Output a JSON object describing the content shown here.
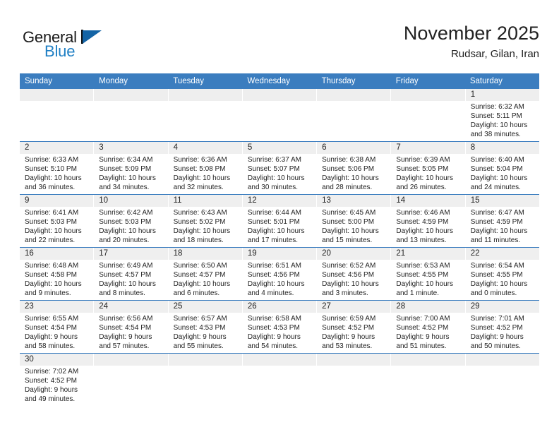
{
  "logo": {
    "word_one": "General",
    "word_two": "Blue",
    "mark": "triangle-flag-icon",
    "blue": "#1f7fc4",
    "dark_blue": "#1464a5"
  },
  "header": {
    "month_title": "November 2025",
    "location": "Rudsar, Gilan, Iran"
  },
  "theme": {
    "header_blue": "#3b7dbf",
    "daynum_band": "#efefef",
    "text": "#222222"
  },
  "weekdays": [
    "Sunday",
    "Monday",
    "Tuesday",
    "Wednesday",
    "Thursday",
    "Friday",
    "Saturday"
  ],
  "weeks": [
    [
      {
        "day": "",
        "sunrise": "",
        "sunset": "",
        "daylight_line1": "",
        "daylight_line2": "",
        "empty": true
      },
      {
        "day": "",
        "sunrise": "",
        "sunset": "",
        "daylight_line1": "",
        "daylight_line2": "",
        "empty": true
      },
      {
        "day": "",
        "sunrise": "",
        "sunset": "",
        "daylight_line1": "",
        "daylight_line2": "",
        "empty": true
      },
      {
        "day": "",
        "sunrise": "",
        "sunset": "",
        "daylight_line1": "",
        "daylight_line2": "",
        "empty": true
      },
      {
        "day": "",
        "sunrise": "",
        "sunset": "",
        "daylight_line1": "",
        "daylight_line2": "",
        "empty": true
      },
      {
        "day": "",
        "sunrise": "",
        "sunset": "",
        "daylight_line1": "",
        "daylight_line2": "",
        "empty": true
      },
      {
        "day": "1",
        "sunrise": "Sunrise: 6:32 AM",
        "sunset": "Sunset: 5:11 PM",
        "daylight_line1": "Daylight: 10 hours",
        "daylight_line2": "and 38 minutes.",
        "empty": false
      }
    ],
    [
      {
        "day": "2",
        "sunrise": "Sunrise: 6:33 AM",
        "sunset": "Sunset: 5:10 PM",
        "daylight_line1": "Daylight: 10 hours",
        "daylight_line2": "and 36 minutes.",
        "empty": false
      },
      {
        "day": "3",
        "sunrise": "Sunrise: 6:34 AM",
        "sunset": "Sunset: 5:09 PM",
        "daylight_line1": "Daylight: 10 hours",
        "daylight_line2": "and 34 minutes.",
        "empty": false
      },
      {
        "day": "4",
        "sunrise": "Sunrise: 6:36 AM",
        "sunset": "Sunset: 5:08 PM",
        "daylight_line1": "Daylight: 10 hours",
        "daylight_line2": "and 32 minutes.",
        "empty": false
      },
      {
        "day": "5",
        "sunrise": "Sunrise: 6:37 AM",
        "sunset": "Sunset: 5:07 PM",
        "daylight_line1": "Daylight: 10 hours",
        "daylight_line2": "and 30 minutes.",
        "empty": false
      },
      {
        "day": "6",
        "sunrise": "Sunrise: 6:38 AM",
        "sunset": "Sunset: 5:06 PM",
        "daylight_line1": "Daylight: 10 hours",
        "daylight_line2": "and 28 minutes.",
        "empty": false
      },
      {
        "day": "7",
        "sunrise": "Sunrise: 6:39 AM",
        "sunset": "Sunset: 5:05 PM",
        "daylight_line1": "Daylight: 10 hours",
        "daylight_line2": "and 26 minutes.",
        "empty": false
      },
      {
        "day": "8",
        "sunrise": "Sunrise: 6:40 AM",
        "sunset": "Sunset: 5:04 PM",
        "daylight_line1": "Daylight: 10 hours",
        "daylight_line2": "and 24 minutes.",
        "empty": false
      }
    ],
    [
      {
        "day": "9",
        "sunrise": "Sunrise: 6:41 AM",
        "sunset": "Sunset: 5:03 PM",
        "daylight_line1": "Daylight: 10 hours",
        "daylight_line2": "and 22 minutes.",
        "empty": false
      },
      {
        "day": "10",
        "sunrise": "Sunrise: 6:42 AM",
        "sunset": "Sunset: 5:03 PM",
        "daylight_line1": "Daylight: 10 hours",
        "daylight_line2": "and 20 minutes.",
        "empty": false
      },
      {
        "day": "11",
        "sunrise": "Sunrise: 6:43 AM",
        "sunset": "Sunset: 5:02 PM",
        "daylight_line1": "Daylight: 10 hours",
        "daylight_line2": "and 18 minutes.",
        "empty": false
      },
      {
        "day": "12",
        "sunrise": "Sunrise: 6:44 AM",
        "sunset": "Sunset: 5:01 PM",
        "daylight_line1": "Daylight: 10 hours",
        "daylight_line2": "and 17 minutes.",
        "empty": false
      },
      {
        "day": "13",
        "sunrise": "Sunrise: 6:45 AM",
        "sunset": "Sunset: 5:00 PM",
        "daylight_line1": "Daylight: 10 hours",
        "daylight_line2": "and 15 minutes.",
        "empty": false
      },
      {
        "day": "14",
        "sunrise": "Sunrise: 6:46 AM",
        "sunset": "Sunset: 4:59 PM",
        "daylight_line1": "Daylight: 10 hours",
        "daylight_line2": "and 13 minutes.",
        "empty": false
      },
      {
        "day": "15",
        "sunrise": "Sunrise: 6:47 AM",
        "sunset": "Sunset: 4:59 PM",
        "daylight_line1": "Daylight: 10 hours",
        "daylight_line2": "and 11 minutes.",
        "empty": false
      }
    ],
    [
      {
        "day": "16",
        "sunrise": "Sunrise: 6:48 AM",
        "sunset": "Sunset: 4:58 PM",
        "daylight_line1": "Daylight: 10 hours",
        "daylight_line2": "and 9 minutes.",
        "empty": false
      },
      {
        "day": "17",
        "sunrise": "Sunrise: 6:49 AM",
        "sunset": "Sunset: 4:57 PM",
        "daylight_line1": "Daylight: 10 hours",
        "daylight_line2": "and 8 minutes.",
        "empty": false
      },
      {
        "day": "18",
        "sunrise": "Sunrise: 6:50 AM",
        "sunset": "Sunset: 4:57 PM",
        "daylight_line1": "Daylight: 10 hours",
        "daylight_line2": "and 6 minutes.",
        "empty": false
      },
      {
        "day": "19",
        "sunrise": "Sunrise: 6:51 AM",
        "sunset": "Sunset: 4:56 PM",
        "daylight_line1": "Daylight: 10 hours",
        "daylight_line2": "and 4 minutes.",
        "empty": false
      },
      {
        "day": "20",
        "sunrise": "Sunrise: 6:52 AM",
        "sunset": "Sunset: 4:56 PM",
        "daylight_line1": "Daylight: 10 hours",
        "daylight_line2": "and 3 minutes.",
        "empty": false
      },
      {
        "day": "21",
        "sunrise": "Sunrise: 6:53 AM",
        "sunset": "Sunset: 4:55 PM",
        "daylight_line1": "Daylight: 10 hours",
        "daylight_line2": "and 1 minute.",
        "empty": false
      },
      {
        "day": "22",
        "sunrise": "Sunrise: 6:54 AM",
        "sunset": "Sunset: 4:55 PM",
        "daylight_line1": "Daylight: 10 hours",
        "daylight_line2": "and 0 minutes.",
        "empty": false
      }
    ],
    [
      {
        "day": "23",
        "sunrise": "Sunrise: 6:55 AM",
        "sunset": "Sunset: 4:54 PM",
        "daylight_line1": "Daylight: 9 hours",
        "daylight_line2": "and 58 minutes.",
        "empty": false
      },
      {
        "day": "24",
        "sunrise": "Sunrise: 6:56 AM",
        "sunset": "Sunset: 4:54 PM",
        "daylight_line1": "Daylight: 9 hours",
        "daylight_line2": "and 57 minutes.",
        "empty": false
      },
      {
        "day": "25",
        "sunrise": "Sunrise: 6:57 AM",
        "sunset": "Sunset: 4:53 PM",
        "daylight_line1": "Daylight: 9 hours",
        "daylight_line2": "and 55 minutes.",
        "empty": false
      },
      {
        "day": "26",
        "sunrise": "Sunrise: 6:58 AM",
        "sunset": "Sunset: 4:53 PM",
        "daylight_line1": "Daylight: 9 hours",
        "daylight_line2": "and 54 minutes.",
        "empty": false
      },
      {
        "day": "27",
        "sunrise": "Sunrise: 6:59 AM",
        "sunset": "Sunset: 4:52 PM",
        "daylight_line1": "Daylight: 9 hours",
        "daylight_line2": "and 53 minutes.",
        "empty": false
      },
      {
        "day": "28",
        "sunrise": "Sunrise: 7:00 AM",
        "sunset": "Sunset: 4:52 PM",
        "daylight_line1": "Daylight: 9 hours",
        "daylight_line2": "and 51 minutes.",
        "empty": false
      },
      {
        "day": "29",
        "sunrise": "Sunrise: 7:01 AM",
        "sunset": "Sunset: 4:52 PM",
        "daylight_line1": "Daylight: 9 hours",
        "daylight_line2": "and 50 minutes.",
        "empty": false
      }
    ],
    [
      {
        "day": "30",
        "sunrise": "Sunrise: 7:02 AM",
        "sunset": "Sunset: 4:52 PM",
        "daylight_line1": "Daylight: 9 hours",
        "daylight_line2": "and 49 minutes.",
        "empty": false
      },
      {
        "day": "",
        "sunrise": "",
        "sunset": "",
        "daylight_line1": "",
        "daylight_line2": "",
        "empty": true
      },
      {
        "day": "",
        "sunrise": "",
        "sunset": "",
        "daylight_line1": "",
        "daylight_line2": "",
        "empty": true
      },
      {
        "day": "",
        "sunrise": "",
        "sunset": "",
        "daylight_line1": "",
        "daylight_line2": "",
        "empty": true
      },
      {
        "day": "",
        "sunrise": "",
        "sunset": "",
        "daylight_line1": "",
        "daylight_line2": "",
        "empty": true
      },
      {
        "day": "",
        "sunrise": "",
        "sunset": "",
        "daylight_line1": "",
        "daylight_line2": "",
        "empty": true
      },
      {
        "day": "",
        "sunrise": "",
        "sunset": "",
        "daylight_line1": "",
        "daylight_line2": "",
        "empty": true
      }
    ]
  ]
}
